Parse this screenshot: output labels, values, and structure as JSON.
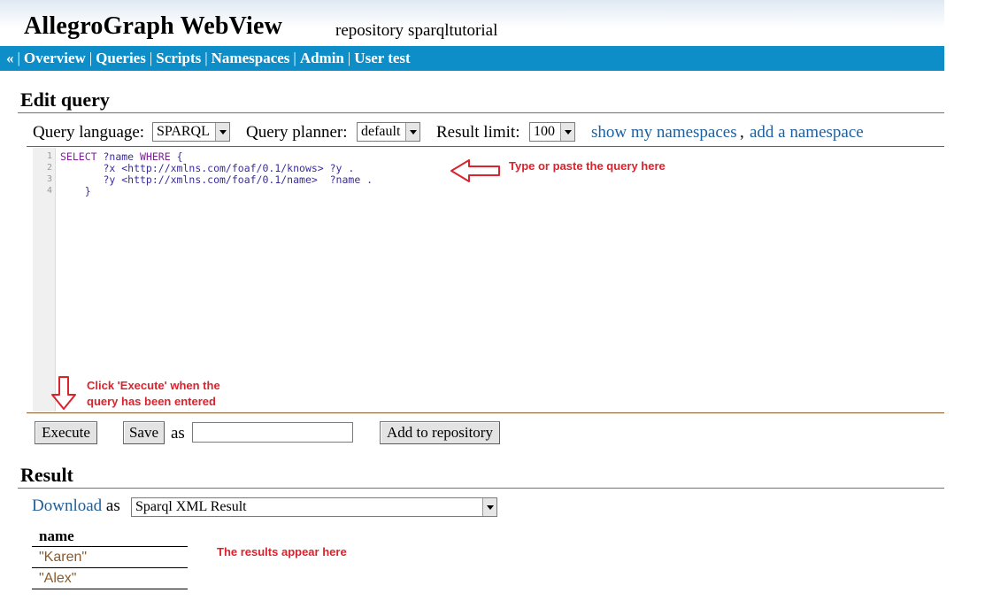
{
  "header": {
    "app_title": "AllegroGraph WebView",
    "repo_prefix": "repository",
    "repo_name": "sparqltutorial"
  },
  "nav": {
    "back": "«",
    "items": [
      "Overview",
      "Queries",
      "Scripts",
      "Namespaces",
      "Admin",
      "User test"
    ]
  },
  "edit_query": {
    "heading": "Edit query",
    "query_language_label": "Query language:",
    "query_language_value": "SPARQL",
    "query_planner_label": "Query planner:",
    "query_planner_value": "default",
    "result_limit_label": "Result limit:",
    "result_limit_value": "100",
    "show_namespaces_link": "show my namespaces",
    "comma": ",",
    "add_namespace_link": "add a namespace"
  },
  "editor": {
    "line_numbers": [
      "1",
      "2",
      "3",
      "4"
    ],
    "lines": [
      {
        "kw": "SELECT",
        "rest": " ?name ",
        "kw2": "WHERE",
        "tail": " {"
      },
      {
        "kw": "",
        "rest": "       ?x <http://xmlns.com/foaf/0.1/knows> ?y .",
        "kw2": "",
        "tail": ""
      },
      {
        "kw": "",
        "rest": "       ?y <http://xmlns.com/foaf/0.1/name>  ?name .",
        "kw2": "",
        "tail": ""
      },
      {
        "kw": "",
        "rest": "    }",
        "kw2": "",
        "tail": ""
      }
    ]
  },
  "annotations": {
    "type_query": "Type or paste the query here",
    "click_execute_1": "Click 'Execute' when the",
    "click_execute_2": "query has been entered",
    "results_appear": "The results appear here"
  },
  "actions": {
    "execute": "Execute",
    "save": "Save",
    "as": "as",
    "save_name_value": "",
    "add_to_repository": "Add to repository"
  },
  "result": {
    "heading": "Result",
    "download_link": "Download",
    "as": "as",
    "format_value": "Sparql XML Result",
    "columns": [
      "name"
    ],
    "rows": [
      "\"Karen\"",
      "\"Alex\""
    ]
  },
  "colors": {
    "nav_bar": "#0d8ec9",
    "link": "#1e5f9c",
    "annotation": "#d9232d",
    "result_value": "#8a5a2b"
  }
}
